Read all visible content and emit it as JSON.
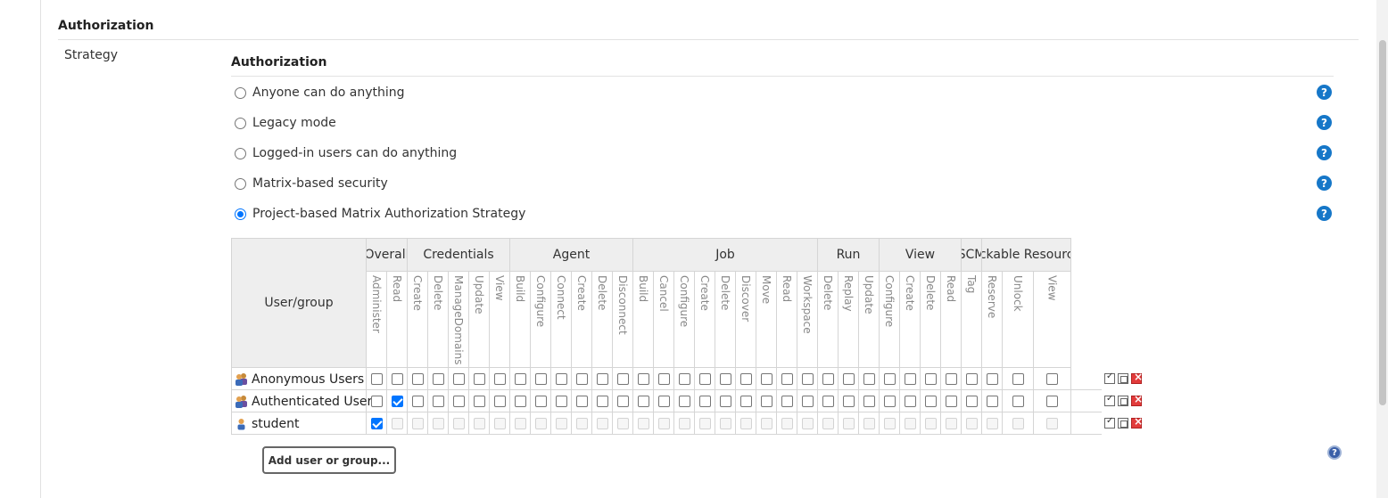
{
  "section": {
    "title": "Authorization",
    "strategy_label": "Strategy"
  },
  "auth": {
    "subtitle": "Authorization",
    "options": [
      {
        "label": "Anyone can do anything",
        "checked": false
      },
      {
        "label": "Legacy mode",
        "checked": false
      },
      {
        "label": "Logged-in users can do anything",
        "checked": false
      },
      {
        "label": "Matrix-based security",
        "checked": false
      },
      {
        "label": "Project-based Matrix Authorization Strategy",
        "checked": true
      }
    ],
    "help_glyph": "?"
  },
  "matrix": {
    "usergroup_header": "User/group",
    "groups": [
      {
        "name": "Overall",
        "perms": [
          "Administer",
          "Read"
        ]
      },
      {
        "name": "Credentials",
        "perms": [
          "Create",
          "Delete",
          "ManageDomains",
          "Update",
          "View"
        ]
      },
      {
        "name": "Agent",
        "perms": [
          "Build",
          "Configure",
          "Connect",
          "Create",
          "Delete",
          "Disconnect"
        ]
      },
      {
        "name": "Job",
        "perms": [
          "Build",
          "Cancel",
          "Configure",
          "Create",
          "Delete",
          "Discover",
          "Move",
          "Read",
          "Workspace"
        ]
      },
      {
        "name": "Run",
        "perms": [
          "Delete",
          "Replay",
          "Update"
        ]
      },
      {
        "name": "View",
        "perms": [
          "Configure",
          "Create",
          "Delete",
          "Read"
        ]
      },
      {
        "name": "SCM",
        "perms": [
          "Tag"
        ]
      },
      {
        "name": "Lockable Resources",
        "perms": [
          "Reserve",
          "Unlock",
          "View"
        ]
      }
    ],
    "rows": [
      {
        "name": "Anonymous Users",
        "icon": "group-icon",
        "checked": [],
        "disabled": false
      },
      {
        "name": "Authenticated Users",
        "icon": "group-icon",
        "checked": [
          1
        ],
        "disabled": false
      },
      {
        "name": "student",
        "icon": "user-icon",
        "checked": [
          0
        ],
        "disabled": true
      }
    ],
    "row_action_icons": [
      "select-all-icon",
      "unselect-all-icon",
      "remove-icon"
    ]
  },
  "add_button": "Add user or group...",
  "footer_help_glyph": "?",
  "colors": {
    "accent": "#0075ff",
    "help": "#1677c8",
    "remove": "#e23b3b"
  }
}
